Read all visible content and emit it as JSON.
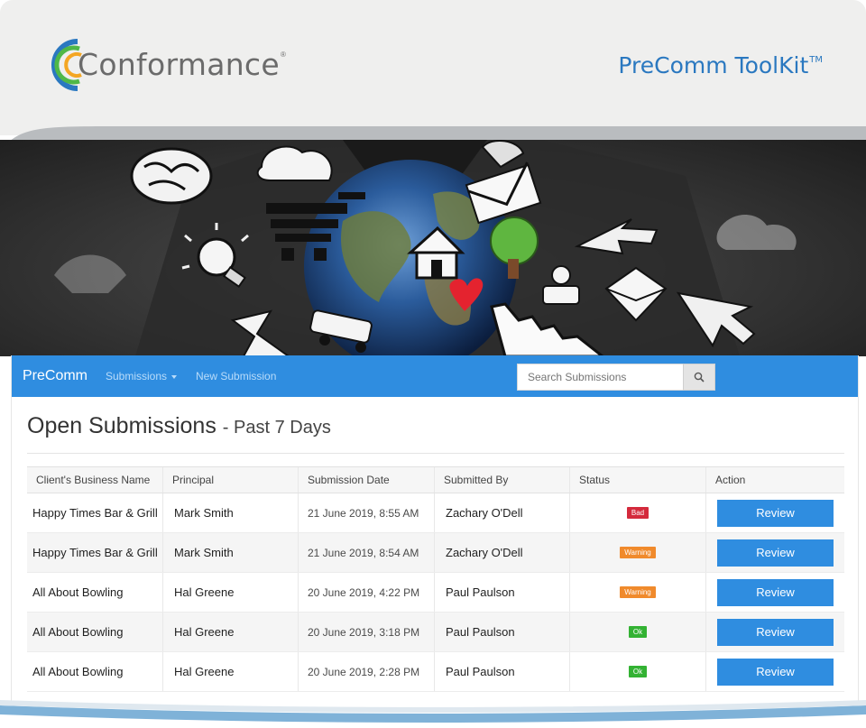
{
  "header": {
    "logo_text": "Conformance",
    "logo_reg": "®",
    "toolkit_title": "PreComm ToolKit",
    "toolkit_tm": "TM"
  },
  "app": {
    "brand": "PreComm",
    "nav": {
      "submissions_label": "Submissions",
      "new_submission_label": "New Submission"
    },
    "search": {
      "placeholder": "Search Submissions",
      "icon": "search-icon"
    },
    "page_title": "Open Submissions",
    "page_subtitle": "- Past 7 Days",
    "table": {
      "columns": [
        "Client's Business Name",
        "Principal",
        "Submission Date",
        "Submitted By",
        "Status",
        "Action"
      ],
      "rows": [
        {
          "client": "Happy Times Bar & Grill",
          "principal": "Mark Smith",
          "date": "21 June 2019, 8:55 AM",
          "submitted_by": "Zachary O'Dell",
          "status": "Bad",
          "action": "Review"
        },
        {
          "client": "Happy Times Bar & Grill",
          "principal": "Mark Smith",
          "date": "21 June 2019, 8:54 AM",
          "submitted_by": "Zachary O'Dell",
          "status": "Warning",
          "action": "Review"
        },
        {
          "client": "All About Bowling",
          "principal": "Hal Greene",
          "date": "20 June 2019, 4:22 PM",
          "submitted_by": "Paul Paulson",
          "status": "Warning",
          "action": "Review"
        },
        {
          "client": "All About Bowling",
          "principal": "Hal Greene",
          "date": "20 June 2019, 3:18 PM",
          "submitted_by": "Paul Paulson",
          "status": "Ok",
          "action": "Review"
        },
        {
          "client": "All About Bowling",
          "principal": "Hal Greene",
          "date": "20 June 2019, 2:28 PM",
          "submitted_by": "Paul Paulson",
          "status": "Ok",
          "action": "Review"
        }
      ]
    }
  },
  "colors": {
    "brand_blue": "#2f8de0",
    "title_blue": "#2a78c0",
    "status_bad": "#d42a3c",
    "status_warning": "#f08a2c",
    "status_ok": "#33b233"
  }
}
